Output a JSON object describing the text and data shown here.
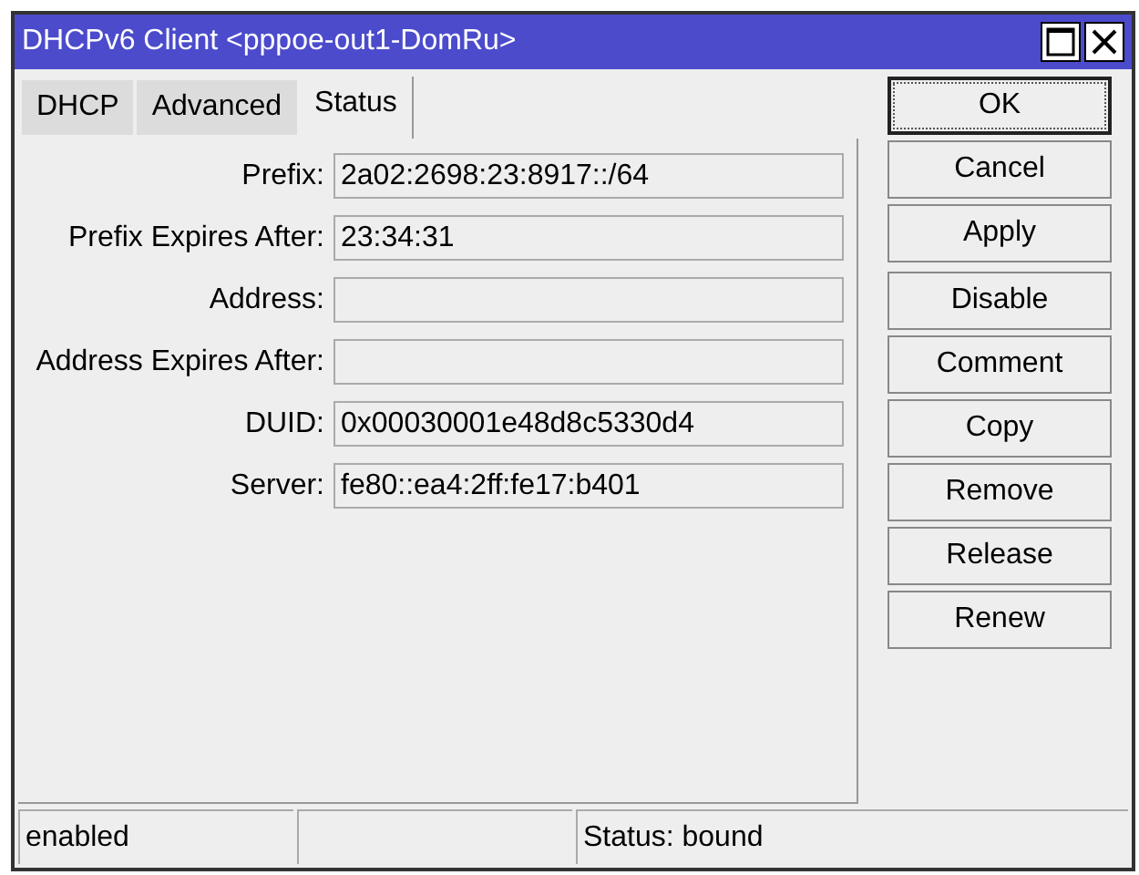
{
  "window": {
    "title": "DHCPv6 Client <pppoe-out1-DomRu>"
  },
  "tabs": [
    {
      "label": "DHCP",
      "selected": false
    },
    {
      "label": "Advanced",
      "selected": false
    },
    {
      "label": "Status",
      "selected": true
    }
  ],
  "fields": [
    {
      "label": "Prefix:",
      "value": "2a02:2698:23:8917::/64"
    },
    {
      "label": "Prefix Expires After:",
      "value": "23:34:31"
    },
    {
      "label": "Address:"
    },
    {
      "label": "Address Expires After:"
    },
    {
      "label": "DUID:",
      "value": "0x00030001e48d8c5330d4"
    },
    {
      "label": "Server:",
      "value": "fe80::ea4:2ff:fe17:b401"
    }
  ],
  "button_groups": [
    [
      {
        "label": "OK",
        "focused": true
      },
      {
        "label": "Cancel",
        "focused": false
      },
      {
        "label": "Apply",
        "focused": false
      }
    ],
    [
      {
        "label": "Disable",
        "focused": false
      },
      {
        "label": "Comment",
        "focused": false
      },
      {
        "label": "Copy",
        "focused": false
      },
      {
        "label": "Remove",
        "focused": false
      },
      {
        "label": "Release",
        "focused": false
      },
      {
        "label": "Renew",
        "focused": false
      }
    ]
  ],
  "status_bar": {
    "left": "enabled",
    "right": "Status: bound"
  }
}
